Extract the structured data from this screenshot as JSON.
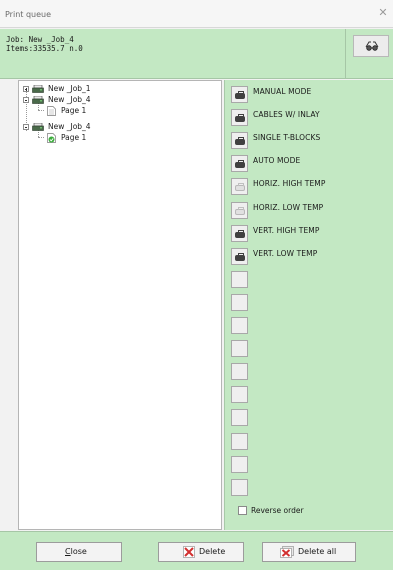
{
  "window": {
    "title": "Print queue",
    "close_icon": "close-icon"
  },
  "header": {
    "job_line": "Job: New _Job_4",
    "items_line": "Items:33535.7 n.0",
    "preview_icon": "eye-glasses-icon"
  },
  "tree": {
    "nodes": [
      {
        "label": "New _Job_1",
        "expander": "plus",
        "icon": "printer-icon"
      },
      {
        "label": "New _Job_4",
        "expander": "minus",
        "icon": "printer-icon"
      },
      {
        "label": "Page 1",
        "icon": "page-icon"
      },
      {
        "label": "New _Job_4",
        "expander": "minus",
        "icon": "printer-icon"
      },
      {
        "label": "Page 1",
        "icon": "page-check-icon"
      }
    ]
  },
  "commands": {
    "items": [
      {
        "label": "MANUAL MODE",
        "icon": "cable-icon",
        "enabled": true
      },
      {
        "label": "CABLES W/ INLAY",
        "icon": "cable-icon",
        "enabled": true
      },
      {
        "label": "SINGLE T-BLOCKS",
        "icon": "cable-icon",
        "enabled": true
      },
      {
        "label": "AUTO MODE",
        "icon": "cable-icon",
        "enabled": true
      },
      {
        "label": "HORIZ. HIGH TEMP",
        "icon": "cable-icon",
        "enabled": false
      },
      {
        "label": "HORIZ. LOW TEMP",
        "icon": "cable-icon",
        "enabled": false
      },
      {
        "label": "VERT. HIGH TEMP",
        "icon": "cable-icon",
        "enabled": true
      },
      {
        "label": "VERT. LOW TEMP",
        "icon": "cable-icon",
        "enabled": true
      }
    ],
    "empty_slots": 10,
    "reverse_order_label": "Reverse order",
    "reverse_order_checked": false
  },
  "footer": {
    "close_label": "Close",
    "close_mnemonic": "C",
    "close_rest": "lose",
    "delete_label": "Delete",
    "delete_all_label": "Delete all",
    "delete_icon": "delete-x-icon",
    "delete_all_icon": "delete-all-x-icon"
  },
  "colors": {
    "panel_green": "#c3e8c3",
    "delete_red": "#d23030"
  }
}
